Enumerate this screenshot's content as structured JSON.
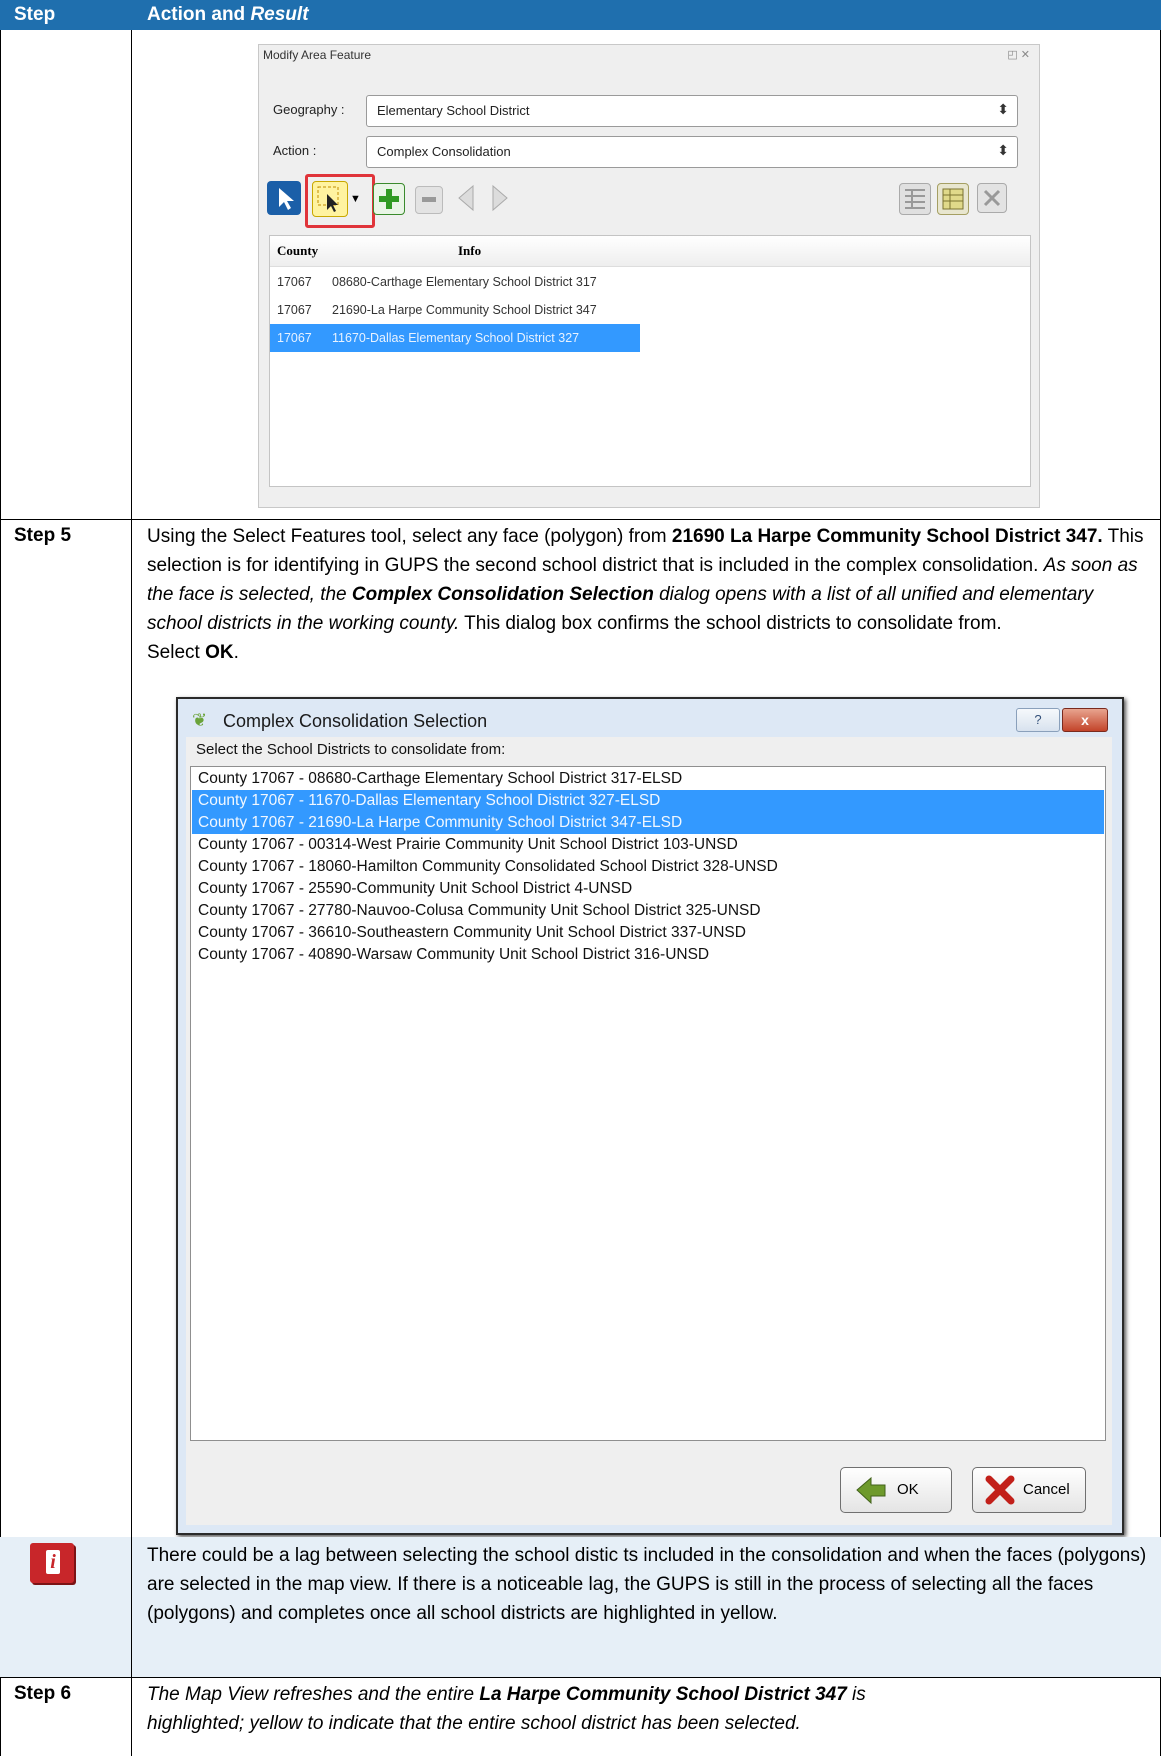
{
  "table": {
    "header": {
      "step": "Step",
      "action": "Action and ",
      "result": "Result"
    },
    "step5": {
      "label": "Step 5",
      "p1": "Using the Select Features tool, select any face (polygon) from ",
      "p1_bold": "21690 La Harpe Community School District 347.",
      "p1b": " This selection is for identifying in GUPS the second school district that is included in the complex consolidation. ",
      "p1_italic": "As soon as the face is selected, the ",
      "p1_bolditalic": "Complex Consolidation Selection",
      "p1_italic2": " dialog opens with a list of all unified and elementary school districts in the working county.",
      "p1c": " This dialog box confirms the school districts to consolidate from.",
      "p2": "Select ",
      "p2_bold": "OK",
      "p2_end": "."
    },
    "note": {
      "text": "There could be a lag between selecting the school distic ts included in the consolidation and when the faces (polygons) are selected in the map view. If there is a noticeable lag, the GUPS is still in the process of selecting all the faces (polygons) and completes once all school districts are highlighted in yellow."
    },
    "step6": {
      "label": "Step 6",
      "t1": "The Map View refreshes and the entire ",
      "t1_bold": "La Harpe Community School District 347",
      "t1_end": " is",
      "t2": "highlighted; yellow to indicate that the entire school district has been selected."
    }
  },
  "modify_panel": {
    "title": "Modify Area Feature",
    "geography_label": "Geography :",
    "geography_value": "Elementary School District",
    "action_label": "Action :",
    "action_value": "Complex Consolidation",
    "columns": [
      "County",
      "Info"
    ],
    "rows": [
      {
        "county": "17067",
        "info": "08680-Carthage Elementary School District 317"
      },
      {
        "county": "17067",
        "info": "21690-La Harpe Community School District 347"
      },
      {
        "county": "17067",
        "info": "11670-Dallas Elementary School District 327"
      }
    ]
  },
  "dialog": {
    "title": "Complex Consolidation Selection",
    "help": "?",
    "close": "x",
    "prompt": "Select the School Districts to consolidate from:",
    "items": [
      "County 17067 - 08680-Carthage Elementary School District 317-ELSD",
      "County 17067 - 11670-Dallas Elementary School District 327-ELSD",
      "County 17067 - 21690-La Harpe Community School District 347-ELSD",
      "County 17067 - 00314-West Prairie Community Unit School District 103-UNSD",
      "County 17067 - 18060-Hamilton Community Consolidated School District 328-UNSD",
      "County 17067 - 25590-Community Unit School District 4-UNSD",
      "County 17067 - 27780-Nauvoo-Colusa Community Unit School District 325-UNSD",
      "County 17067 - 36610-Southeastern Community Unit School District 337-UNSD",
      "County 17067 - 40890-Warsaw Community Unit School District 316-UNSD"
    ],
    "ok": "OK",
    "cancel": "Cancel"
  },
  "colors": {
    "header": "#1f6fae",
    "selection": "#3399ff",
    "note_bg": "#e6eff7"
  }
}
